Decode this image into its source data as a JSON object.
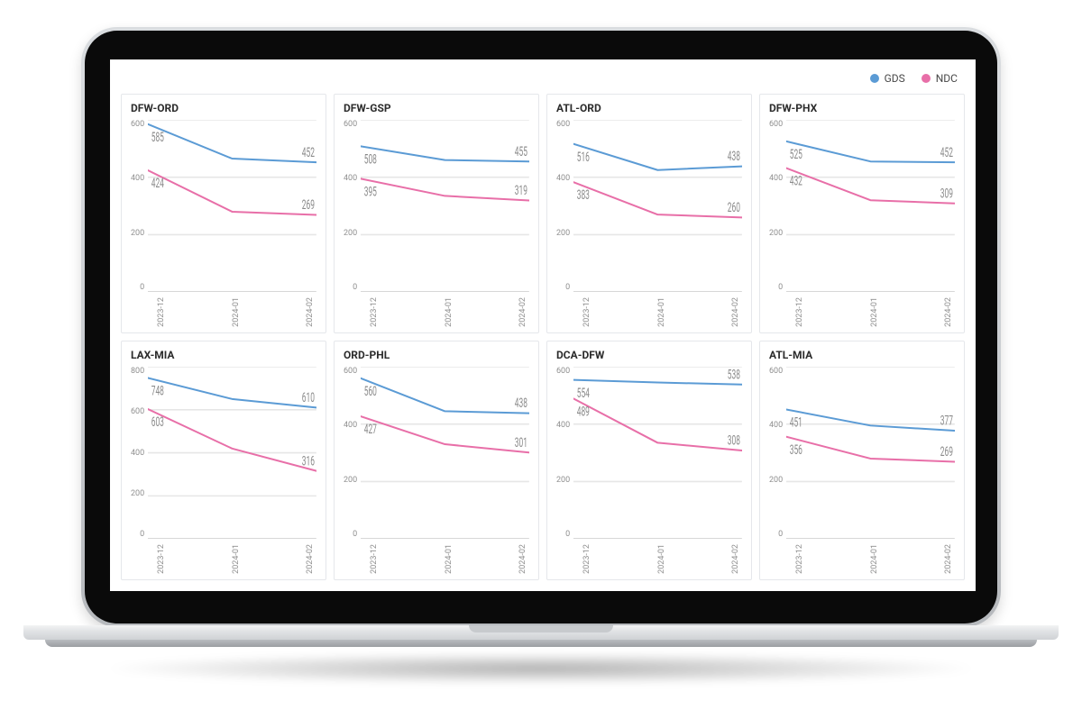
{
  "legend": {
    "gds": {
      "label": "GDS",
      "color": "#5B9BD5"
    },
    "ndc": {
      "label": "NDC",
      "color": "#E86FA8"
    }
  },
  "chart_data": [
    {
      "type": "line",
      "title": "DFW-ORD",
      "categories": [
        "2023-12",
        "2024-01",
        "2024-02"
      ],
      "series": [
        {
          "name": "GDS",
          "color": "#5B9BD5",
          "values": [
            585,
            465,
            452
          ]
        },
        {
          "name": "NDC",
          "color": "#E86FA8",
          "values": [
            424,
            280,
            269
          ]
        }
      ],
      "ylim": [
        0,
        600
      ],
      "ystep": 200
    },
    {
      "type": "line",
      "title": "DFW-GSP",
      "categories": [
        "2023-12",
        "2024-01",
        "2024-02"
      ],
      "series": [
        {
          "name": "GDS",
          "color": "#5B9BD5",
          "values": [
            508,
            460,
            455
          ]
        },
        {
          "name": "NDC",
          "color": "#E86FA8",
          "values": [
            395,
            335,
            319
          ]
        }
      ],
      "ylim": [
        0,
        600
      ],
      "ystep": 200
    },
    {
      "type": "line",
      "title": "ATL-ORD",
      "categories": [
        "2023-12",
        "2024-01",
        "2024-02"
      ],
      "series": [
        {
          "name": "GDS",
          "color": "#5B9BD5",
          "values": [
            516,
            425,
            438
          ]
        },
        {
          "name": "NDC",
          "color": "#E86FA8",
          "values": [
            383,
            270,
            260
          ]
        }
      ],
      "ylim": [
        0,
        600
      ],
      "ystep": 200
    },
    {
      "type": "line",
      "title": "DFW-PHX",
      "categories": [
        "2023-12",
        "2024-01",
        "2024-02"
      ],
      "series": [
        {
          "name": "GDS",
          "color": "#5B9BD5",
          "values": [
            525,
            455,
            452
          ]
        },
        {
          "name": "NDC",
          "color": "#E86FA8",
          "values": [
            432,
            320,
            309
          ]
        }
      ],
      "ylim": [
        0,
        600
      ],
      "ystep": 200
    },
    {
      "type": "line",
      "title": "LAX-MIA",
      "categories": [
        "2023-12",
        "2024-01",
        "2024-02"
      ],
      "series": [
        {
          "name": "GDS",
          "color": "#5B9BD5",
          "values": [
            748,
            650,
            610
          ]
        },
        {
          "name": "NDC",
          "color": "#E86FA8",
          "values": [
            603,
            420,
            316
          ]
        }
      ],
      "ylim": [
        0,
        800
      ],
      "ystep": 200
    },
    {
      "type": "line",
      "title": "ORD-PHL",
      "categories": [
        "2023-12",
        "2024-01",
        "2024-02"
      ],
      "series": [
        {
          "name": "GDS",
          "color": "#5B9BD5",
          "values": [
            560,
            445,
            438
          ]
        },
        {
          "name": "NDC",
          "color": "#E86FA8",
          "values": [
            427,
            330,
            301
          ]
        }
      ],
      "ylim": [
        0,
        600
      ],
      "ystep": 200
    },
    {
      "type": "line",
      "title": "DCA-DFW",
      "categories": [
        "2023-12",
        "2024-01",
        "2024-02"
      ],
      "series": [
        {
          "name": "GDS",
          "color": "#5B9BD5",
          "values": [
            554,
            545,
            538
          ]
        },
        {
          "name": "NDC",
          "color": "#E86FA8",
          "values": [
            489,
            335,
            308
          ]
        }
      ],
      "ylim": [
        0,
        600
      ],
      "ystep": 200
    },
    {
      "type": "line",
      "title": "ATL-MIA",
      "categories": [
        "2023-12",
        "2024-01",
        "2024-02"
      ],
      "series": [
        {
          "name": "GDS",
          "color": "#5B9BD5",
          "values": [
            451,
            395,
            377
          ]
        },
        {
          "name": "NDC",
          "color": "#E86FA8",
          "values": [
            356,
            280,
            269
          ]
        }
      ],
      "ylim": [
        0,
        600
      ],
      "ystep": 200
    }
  ]
}
